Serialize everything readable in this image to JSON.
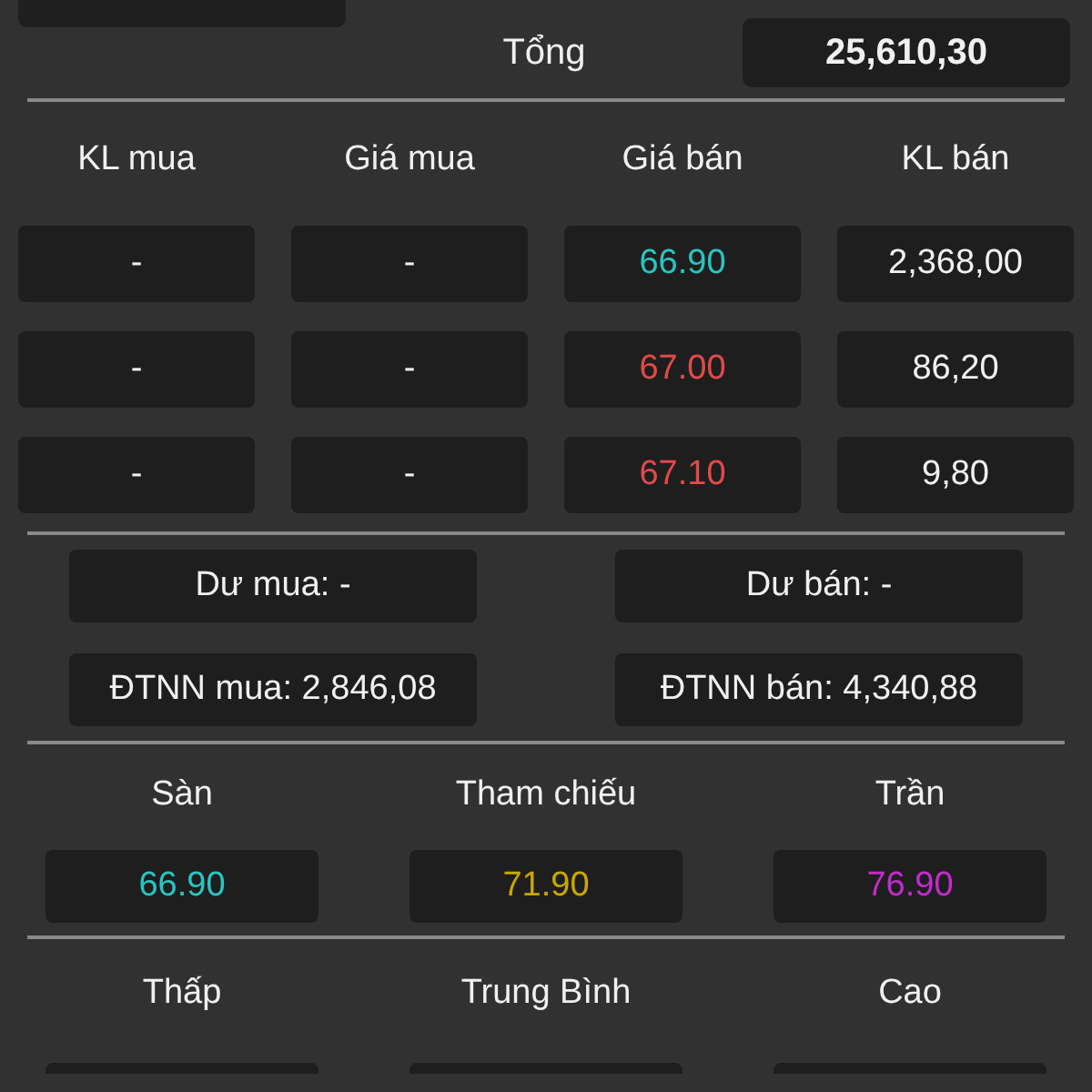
{
  "total": {
    "label": "Tổng",
    "value": "25,610,30"
  },
  "order_book": {
    "columns": [
      "KL mua",
      "Giá mua",
      "Giá bán",
      "KL bán"
    ],
    "rows": [
      {
        "buy_volume": "-",
        "buy_price": "-",
        "sell_price": {
          "text": "66.90",
          "color": "#2ac4c0"
        },
        "sell_volume": "2,368,00"
      },
      {
        "buy_volume": "-",
        "buy_price": "-",
        "sell_price": {
          "text": "67.00",
          "color": "#e04a4a"
        },
        "sell_volume": "86,20"
      },
      {
        "buy_volume": "-",
        "buy_price": "-",
        "sell_price": {
          "text": "67.10",
          "color": "#e04a4a"
        },
        "sell_volume": "9,80"
      }
    ]
  },
  "summary": [
    [
      "Dư mua: -",
      "Dư bán: -"
    ],
    [
      "ĐTNN mua: 2,846,08",
      "ĐTNN bán: 4,340,88"
    ]
  ],
  "reference_prices": [
    {
      "label": "Sàn",
      "value": "66.90",
      "color": "#2ac4c0"
    },
    {
      "label": "Tham chiếu",
      "value": "71.90",
      "color": "#c9a800"
    },
    {
      "label": "Trần",
      "value": "76.90",
      "color": "#c22ccb"
    }
  ],
  "day_range_headers": [
    "Thấp",
    "Trung Bình",
    "Cao"
  ]
}
